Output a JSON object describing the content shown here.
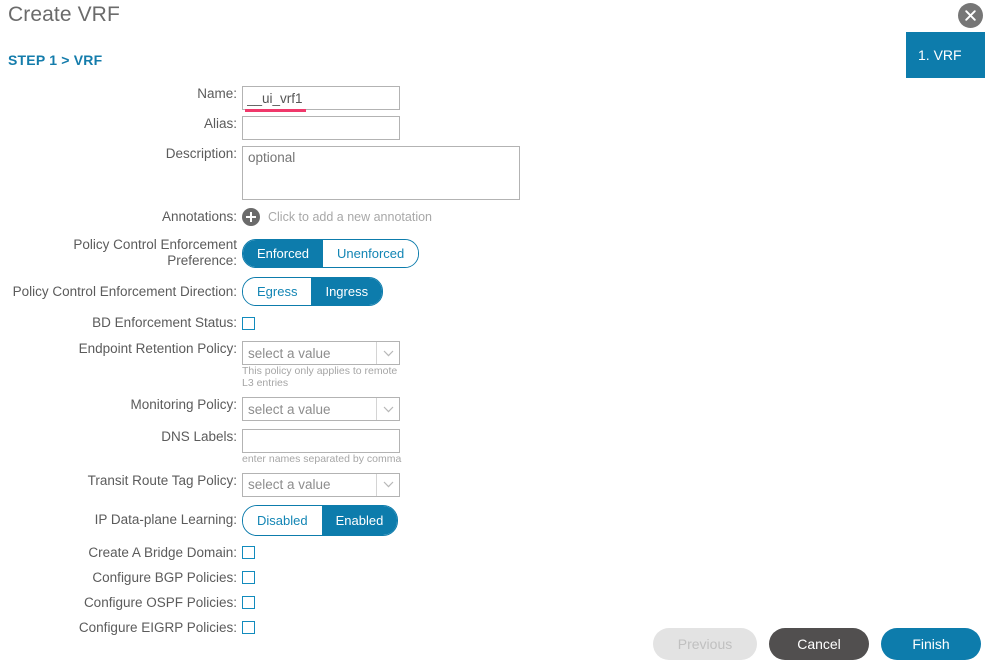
{
  "dialog": {
    "title": "Create VRF",
    "close_icon": "close-icon",
    "breadcrumb": "STEP 1 > VRF",
    "step_tab": "1. VRF"
  },
  "form": {
    "name": {
      "label": "Name:",
      "value": "__ui_vrf1",
      "placeholder": ""
    },
    "alias": {
      "label": "Alias:",
      "value": "",
      "placeholder": ""
    },
    "description": {
      "label": "Description:",
      "value": "",
      "placeholder": "optional"
    },
    "annotations": {
      "label": "Annotations:",
      "add_icon": "plus-circle-icon",
      "hint": "Click to add a new annotation"
    },
    "policy_control_enforcement_preference": {
      "label": "Policy Control Enforcement Preference:",
      "options": [
        "Enforced",
        "Unenforced"
      ],
      "selected": "Enforced"
    },
    "policy_control_enforcement_direction": {
      "label": "Policy Control Enforcement Direction:",
      "options": [
        "Egress",
        "Ingress"
      ],
      "selected": "Ingress"
    },
    "bd_enforcement_status": {
      "label": "BD Enforcement Status:",
      "checked": false
    },
    "endpoint_retention_policy": {
      "label": "Endpoint Retention Policy:",
      "value": "select a value",
      "hint": "This policy only applies to remote L3 entries"
    },
    "monitoring_policy": {
      "label": "Monitoring Policy:",
      "value": "select a value"
    },
    "dns_labels": {
      "label": "DNS Labels:",
      "value": "",
      "hint": "enter names separated by comma"
    },
    "transit_route_tag_policy": {
      "label": "Transit Route Tag Policy:",
      "value": "select a value"
    },
    "ip_dataplane_learning": {
      "label": "IP Data-plane Learning:",
      "options": [
        "Disabled",
        "Enabled"
      ],
      "selected": "Enabled"
    },
    "create_a_bridge_domain": {
      "label": "Create A Bridge Domain:",
      "checked": false
    },
    "configure_bgp_policies": {
      "label": "Configure BGP Policies:",
      "checked": false
    },
    "configure_ospf_policies": {
      "label": "Configure OSPF Policies:",
      "checked": false
    },
    "configure_eigrp_policies": {
      "label": "Configure EIGRP Policies:",
      "checked": false
    }
  },
  "footer": {
    "previous": "Previous",
    "cancel": "Cancel",
    "finish": "Finish"
  },
  "colors": {
    "accent_blue": "#0d7cac",
    "link_blue": "#147cab",
    "validation_pink": "#f0386b",
    "cancel_gray": "#514f4f",
    "disabled_gray": "#e3e3e3"
  }
}
